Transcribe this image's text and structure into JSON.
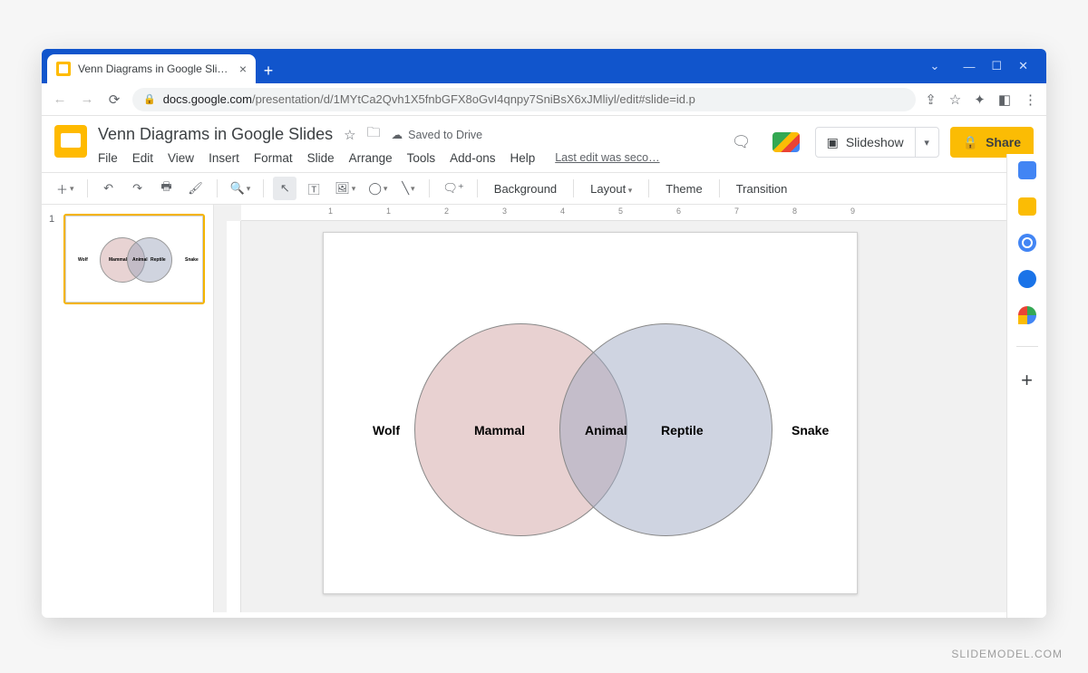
{
  "browser": {
    "tab_title": "Venn Diagrams in Google Slides",
    "url_host": "docs.google.com",
    "url_path": "/presentation/d/1MYtCa2Qvh1X5fnbGFX8oGvI4qnpy7SniBsX6xJMliyl/edit#slide=id.p"
  },
  "doc": {
    "title": "Venn Diagrams in Google Slides",
    "saved_status": "Saved to Drive",
    "last_edit": "Last edit was seco…"
  },
  "menubar": {
    "file": "File",
    "edit": "Edit",
    "view": "View",
    "insert": "Insert",
    "format": "Format",
    "slide": "Slide",
    "arrange": "Arrange",
    "tools": "Tools",
    "addons": "Add-ons",
    "help": "Help"
  },
  "header_actions": {
    "slideshow": "Slideshow",
    "share": "Share"
  },
  "toolbar": {
    "background": "Background",
    "layout": "Layout",
    "theme": "Theme",
    "transition": "Transition"
  },
  "filmstrip": {
    "slide_number": "1"
  },
  "venn": {
    "outer_left": "Wolf",
    "inner_left": "Mammal",
    "center": "Animal",
    "inner_right": "Reptile",
    "outer_right": "Snake"
  },
  "ruler_numbers": [
    "1",
    "1",
    "2",
    "3",
    "4",
    "5",
    "6",
    "7",
    "8",
    "9"
  ],
  "watermark": "SLIDEMODEL.COM"
}
